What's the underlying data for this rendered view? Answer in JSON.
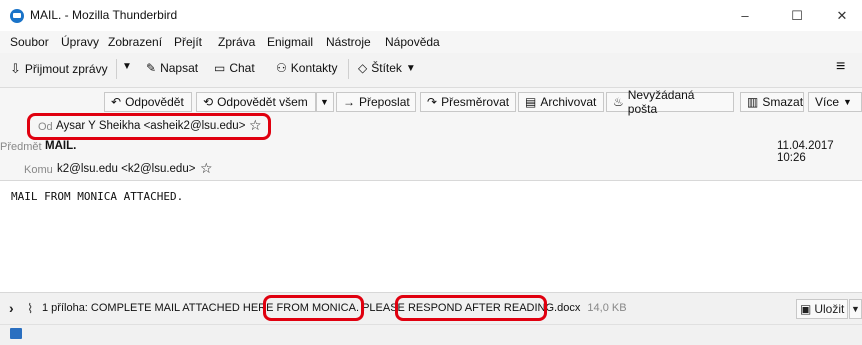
{
  "window": {
    "title": "MAIL. - Mozilla Thunderbird",
    "minimize": "–",
    "maximize": "☐",
    "close": "✕"
  },
  "menu": [
    "Soubor",
    "Úpravy",
    "Zobrazení",
    "Přejít",
    "Zpráva",
    "Enigmail",
    "Nástroje",
    "Nápověda"
  ],
  "toolbar": {
    "get_mail": "Přijmout zprávy",
    "write": "Napsat",
    "chat": "Chat",
    "contacts": "Kontakty",
    "tag": "Štítek",
    "menu_icon": "≡"
  },
  "message_actions": {
    "reply": "Odpovědět",
    "reply_all": "Odpovědět všem",
    "forward": "Přeposlat",
    "redirect": "Přesměrovat",
    "archive": "Archivovat",
    "junk": "Nevyžádaná pošta",
    "delete": "Smazat",
    "more": "Více"
  },
  "headers": {
    "from_label": "Od",
    "from_value": "Aysar Y Sheikha <asheik2@lsu.edu>",
    "subject_label": "Předmět",
    "subject_value": "MAIL.",
    "date": "11.04.2017 10:26",
    "to_label": "Komu",
    "to_value": "k2@lsu.edu <k2@lsu.edu>"
  },
  "body": {
    "text": "MAIL FROM MONICA ATTACHED."
  },
  "attachment": {
    "toggle": "›",
    "summary_a": "1 příloha: COMPLETE MAIL ATTACHED HERE",
    "summary_b": " FROM MONICA.",
    "summary_c": " PLEASE",
    "summary_d": " RESPOND AFTER READING.",
    "summary_e": "docx",
    "size": "14,0 KB",
    "save": "Uložit"
  },
  "colors": {
    "highlight": "#e0000f",
    "accent": "#1a73c8"
  }
}
